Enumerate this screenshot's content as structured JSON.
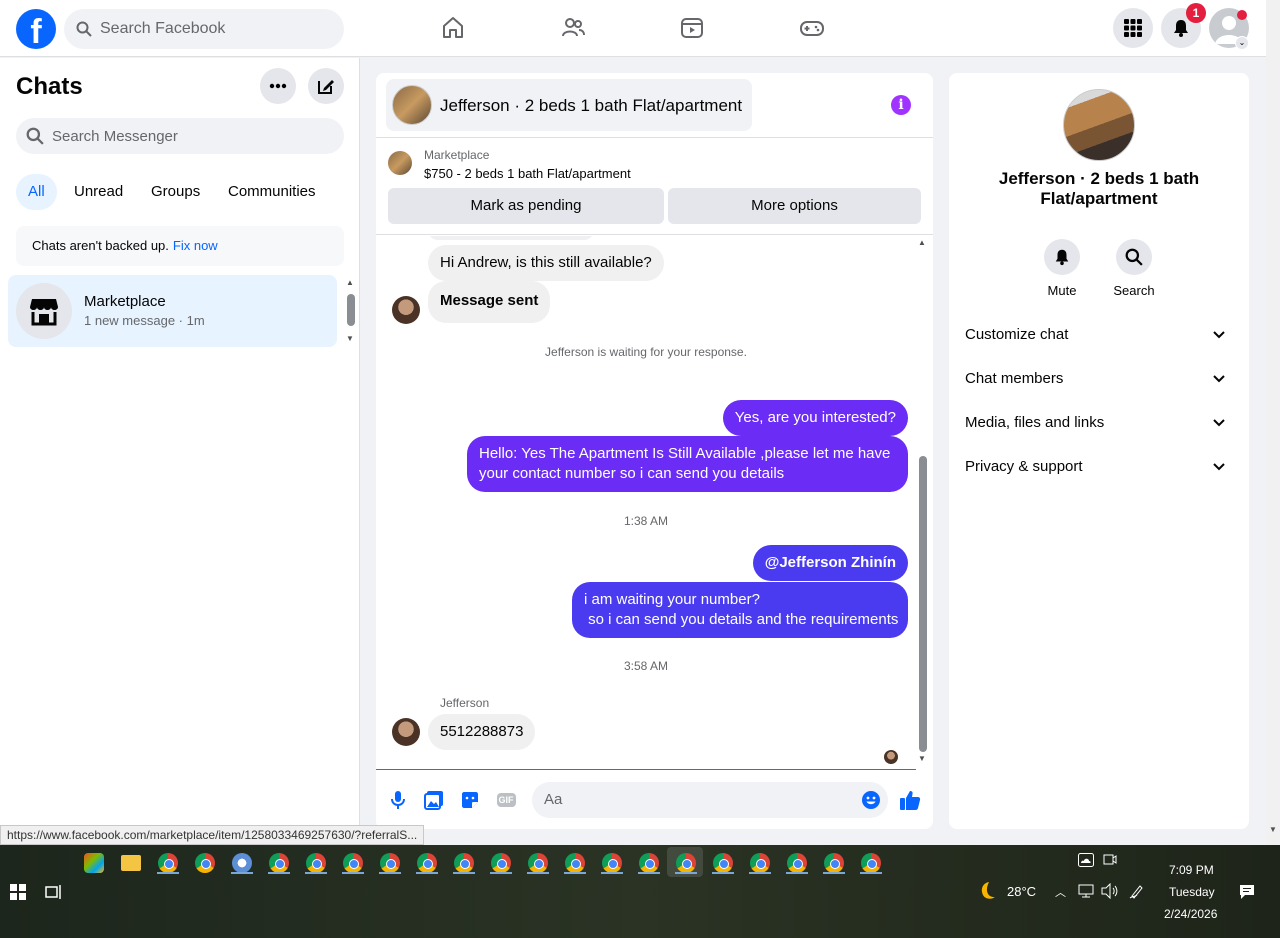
{
  "topbar": {
    "search_placeholder": "Search Facebook",
    "notifications_count": "1"
  },
  "left": {
    "title": "Chats",
    "search_placeholder": "Search Messenger",
    "tabs": [
      "All",
      "Unread",
      "Groups",
      "Communities"
    ],
    "backup_text": "Chats aren't backed up.",
    "backup_link": "Fix now",
    "chat_item": {
      "name": "Marketplace",
      "sub": "1 new message · 1m"
    }
  },
  "chat": {
    "header_title": "Jefferson · 2 beds 1 bath Flat/apartment",
    "marketplace_label": "Marketplace",
    "listing": "$750 - 2 beds 1 bath Flat/apartment",
    "mark_pending": "Mark as pending",
    "more_options": "More options",
    "messages": {
      "m1": "Hi Andrew, is this still available?",
      "m2": "Message sent",
      "waiting": "Jefferson is waiting for your response.",
      "m3": "Yes, are you interested?",
      "m4": "Hello: Yes The Apartment Is Still Available ,please let me have your contact number so i can send you details",
      "time1": "1:38 AM",
      "m5": "@Jefferson Zhinín",
      "m6_line1": "i am waiting your number?",
      "m6_line2": " so i can send you details and the requirements",
      "time2": "3:58 AM",
      "sender": "Jefferson",
      "m7": "5512288873"
    },
    "composer_placeholder": "Aa",
    "gif_label": "GIF"
  },
  "right": {
    "title": "Jefferson · 2 beds 1 bath Flat/apartment",
    "mute": "Mute",
    "search": "Search",
    "items": [
      "Customize chat",
      "Chat members",
      "Media, files and links",
      "Privacy & support"
    ]
  },
  "status_url": "https://www.facebook.com/marketplace/item/1258033469257630/?referralS...",
  "taskbar": {
    "temperature": "28°C",
    "time": "7:09 PM",
    "day": "Tuesday",
    "date": "2/24/2026"
  },
  "colors": {
    "brand_blue": "#0866ff",
    "outgoing_purple": "#6b2cf5",
    "outgoing_blue": "#4a3bf0",
    "info_purple": "#a033ff",
    "badge_red": "#e41e3f"
  }
}
